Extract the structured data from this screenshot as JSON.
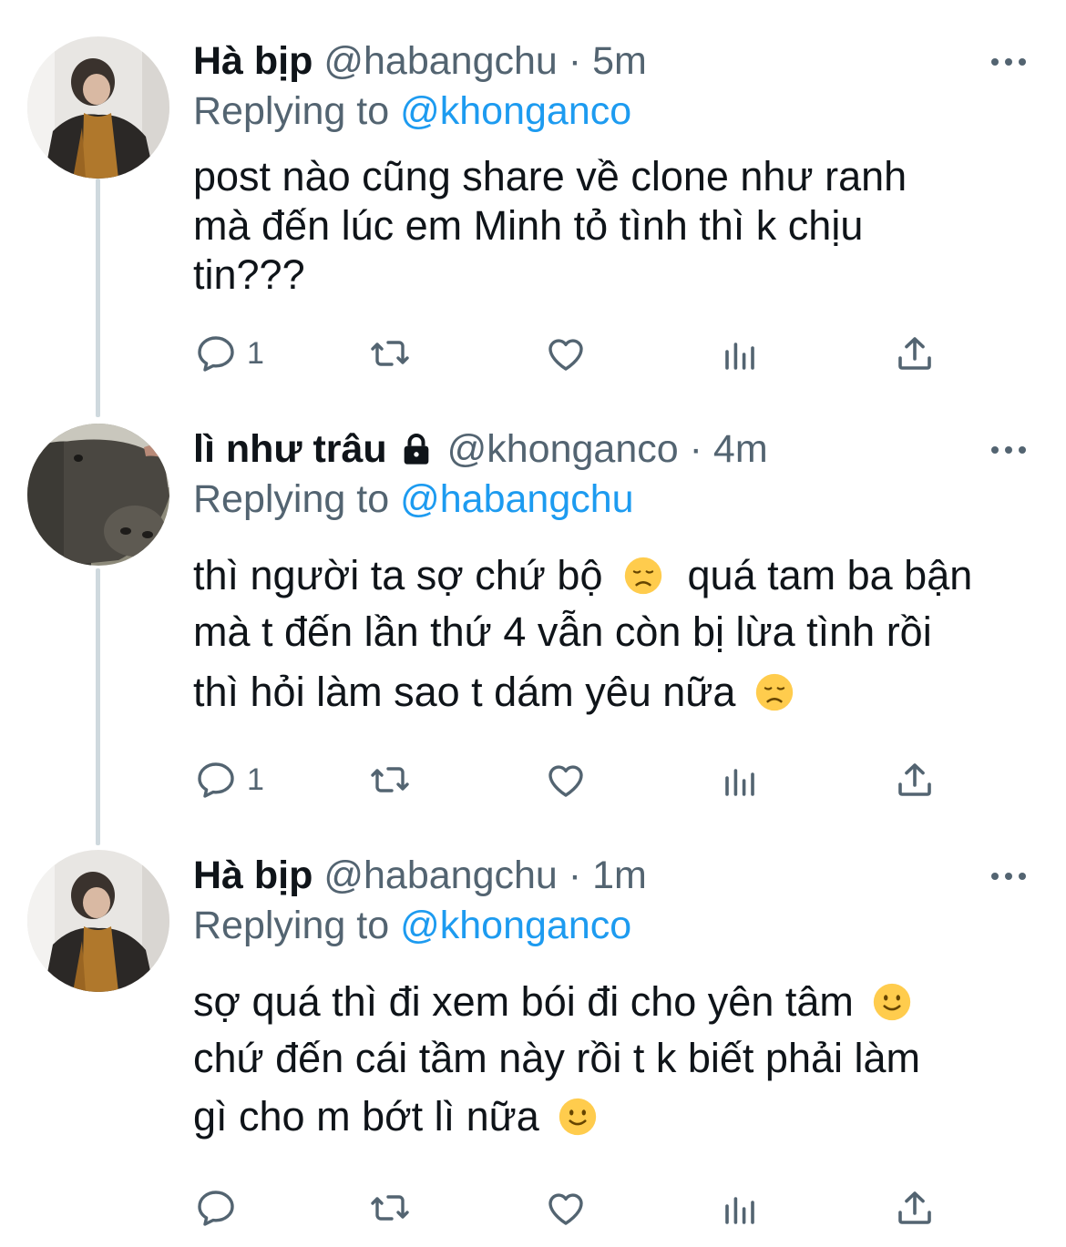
{
  "tweets": [
    {
      "name": "Hà bịp",
      "handle": "@habangchu",
      "time": "5m",
      "replying_prefix": "Replying to",
      "replying_handle": "@khonganco",
      "lines": [
        "post nào cũng share về clone như ranh",
        "mà đến lúc em Minh tỏ tình thì k chịu",
        "tin???"
      ],
      "reply_count": "1",
      "avatar": "girl-with-scarf",
      "locked": false
    },
    {
      "name": "lì như trâu",
      "handle": "@khonganco",
      "time": "4m",
      "replying_prefix": "Replying to",
      "replying_handle": "@habangchu",
      "lines": [
        "thì người ta sợ chứ bộ",
        "quá tam ba bận",
        "mà t đến lần thứ 4 vẫn còn bị lừa tình rồi",
        "thì hỏi làm sao t dám yêu nữa"
      ],
      "reply_count": "1",
      "avatar": "buffalo",
      "locked": true
    },
    {
      "name": "Hà bịp",
      "handle": "@habangchu",
      "time": "1m",
      "replying_prefix": "Replying to",
      "replying_handle": "@khonganco",
      "lines": [
        "sợ quá thì đi xem bói đi cho yên tâm",
        "chứ đến cái tầm này rồi t k biết phải làm",
        "gì cho m bớt lì nữa"
      ],
      "reply_count": "",
      "avatar": "girl-with-scarf",
      "locked": false
    }
  ],
  "separator": "·",
  "icons": {
    "reply": "reply-icon",
    "retweet": "retweet-icon",
    "like": "heart-icon",
    "analytics": "analytics-icon",
    "share": "share-icon",
    "more": "more-icon",
    "lock": "lock-icon",
    "emoji_disappointed": "disappointed-face-icon",
    "emoji_smile": "slightly-smiling-face-icon"
  },
  "colors": {
    "text": "#0f1419",
    "secondary": "#536471",
    "link": "#1d9bf0",
    "thread_line": "#cfd9de"
  }
}
